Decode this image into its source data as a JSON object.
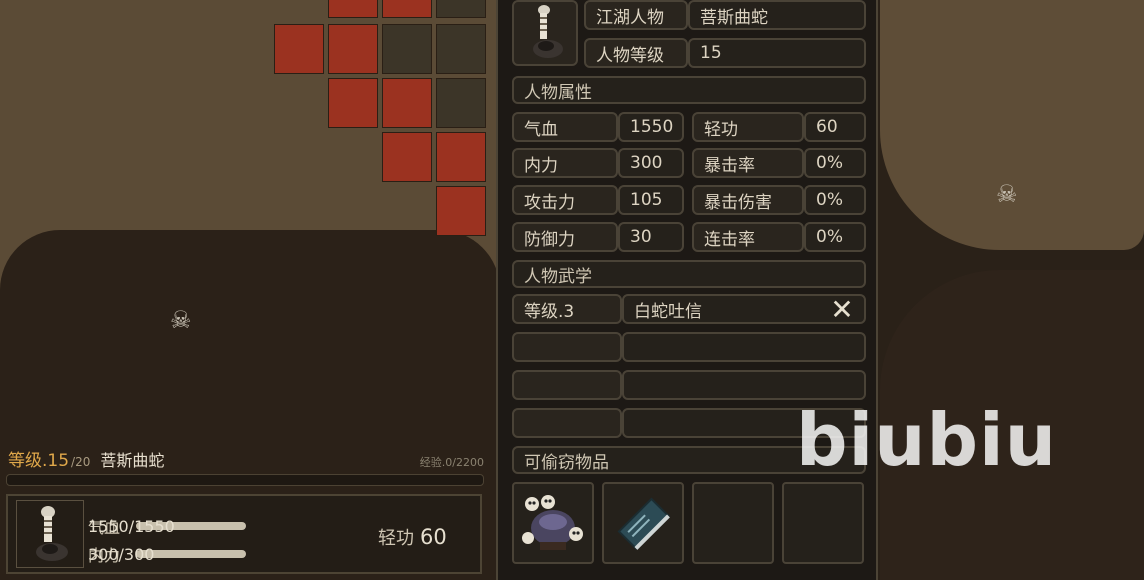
{
  "hud": {
    "level_label": "等级.15",
    "level_max": "/20",
    "name": "菩斯曲蛇",
    "exp": "经验.0/2200",
    "hp_label": "气血",
    "hp_value": "1550/1550",
    "mp_label": "内力",
    "mp_value": "300/300",
    "speed_label": "轻功",
    "speed_value": "60"
  },
  "panel": {
    "identity_label": "江湖人物",
    "identity_value": "菩斯曲蛇",
    "char_level_label": "人物等级",
    "char_level_value": "15",
    "attributes_title": "人物属性",
    "attributes": [
      {
        "label": "气血",
        "value": "1550"
      },
      {
        "label": "轻功",
        "value": "60"
      },
      {
        "label": "内力",
        "value": "300"
      },
      {
        "label": "暴击率",
        "value": "0%"
      },
      {
        "label": "攻击力",
        "value": "105"
      },
      {
        "label": "暴击伤害",
        "value": "0%"
      },
      {
        "label": "防御力",
        "value": "30"
      },
      {
        "label": "连击率",
        "value": "0%"
      }
    ],
    "martial_title": "人物武学",
    "martial": [
      {
        "level": "等级.3",
        "skill": "白蛇吐信"
      },
      {
        "level": "",
        "skill": ""
      },
      {
        "level": "",
        "skill": ""
      },
      {
        "level": "",
        "skill": ""
      }
    ],
    "loot_title": "可偷窃物品"
  },
  "watermark": "biubiu",
  "colors": {
    "level_orange": "#e0a84a",
    "tile_red": "#9b3220",
    "panel_bg": "#1d1915",
    "border": "#4a4337"
  }
}
